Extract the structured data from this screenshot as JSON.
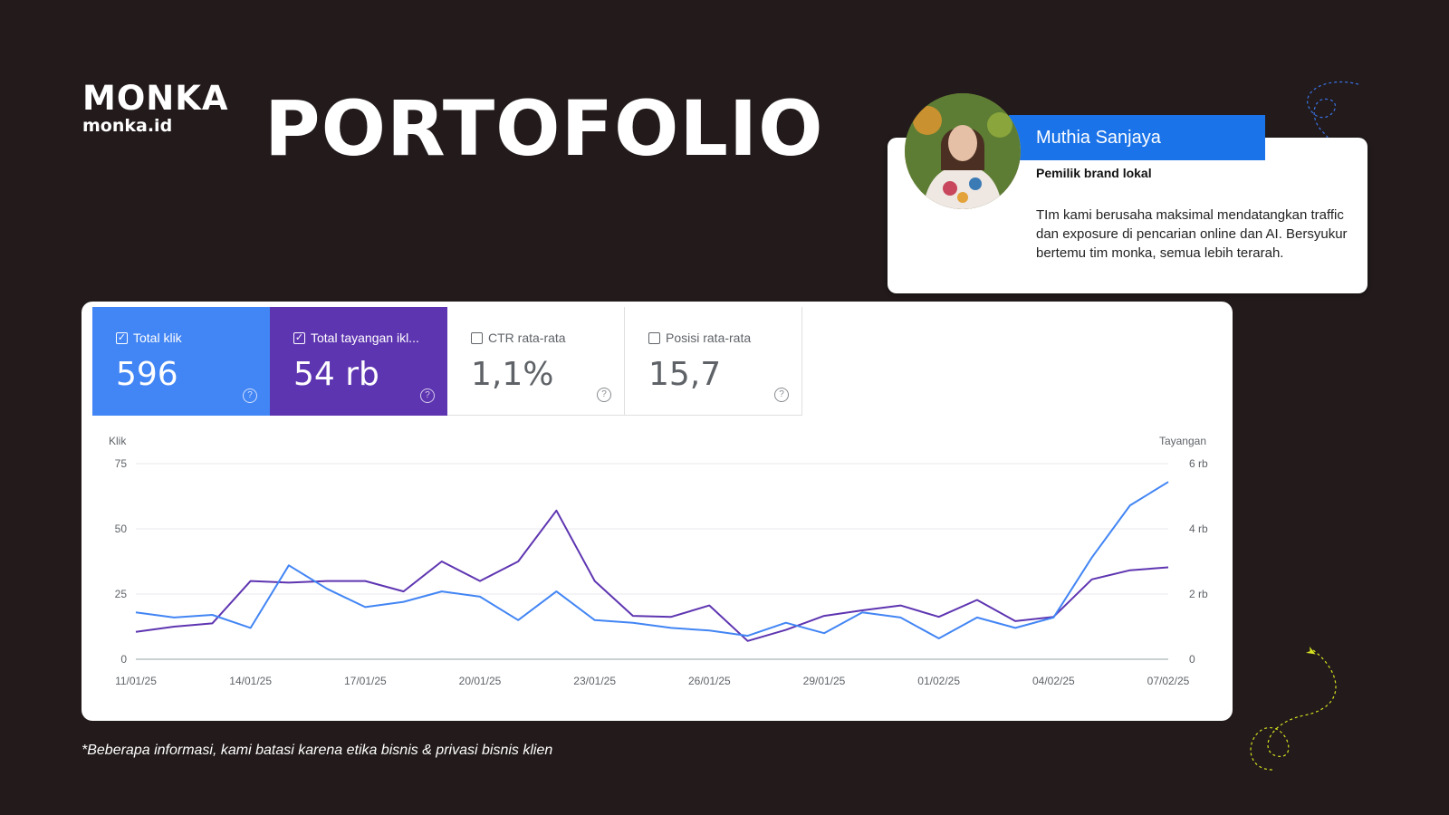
{
  "brand": {
    "wordmark": "MONKA",
    "domain": "monka.id"
  },
  "page_title": "PORTOFOLIO",
  "testimonial": {
    "name": "Muthia Sanjaya",
    "role": "Pemilik brand lokal",
    "quote": "TIm kami berusaha maksimal mendatangkan traffic dan exposure di pencarian online dan AI. Bersyukur bertemu tim monka, semua lebih terarah."
  },
  "metrics": [
    {
      "label": "Total klik",
      "value": "596",
      "checked": true,
      "color": "#4285f4"
    },
    {
      "label": "Total tayangan ikl...",
      "value": "54 rb",
      "checked": true,
      "color": "#5e35b1"
    },
    {
      "label": "CTR rata-rata",
      "value": "1,1%",
      "checked": false
    },
    {
      "label": "Posisi rata-rata",
      "value": "15,7",
      "checked": false
    }
  ],
  "chart_data": {
    "type": "line",
    "left_axis_label": "Klik",
    "right_axis_label": "Tayangan",
    "left_ticks": [
      "0",
      "25",
      "50",
      "75"
    ],
    "right_ticks": [
      "0",
      "2 rb",
      "4 rb",
      "6 rb"
    ],
    "ylim_left": [
      0,
      75
    ],
    "ylim_right": [
      0,
      6000
    ],
    "x_tick_labels": [
      "11/01/25",
      "14/01/25",
      "17/01/25",
      "20/01/25",
      "23/01/25",
      "26/01/25",
      "29/01/25",
      "01/02/25",
      "04/02/25",
      "07/02/25"
    ],
    "x": [
      "11/01/25",
      "12/01/25",
      "13/01/25",
      "14/01/25",
      "15/01/25",
      "16/01/25",
      "17/01/25",
      "18/01/25",
      "19/01/25",
      "20/01/25",
      "21/01/25",
      "22/01/25",
      "23/01/25",
      "24/01/25",
      "25/01/25",
      "26/01/25",
      "27/01/25",
      "28/01/25",
      "29/01/25",
      "30/01/25",
      "31/01/25",
      "01/02/25",
      "02/02/25",
      "03/02/25",
      "04/02/25",
      "05/02/25",
      "06/02/25",
      "07/02/25"
    ],
    "grid": true,
    "series": [
      {
        "name": "Total klik",
        "axis": "left",
        "color": "#4285f4",
        "values": [
          18,
          16,
          17,
          12,
          36,
          27,
          20,
          22,
          26,
          24,
          15,
          26,
          15,
          14,
          12,
          11,
          9,
          14,
          10,
          18,
          16,
          8,
          16,
          12,
          16,
          39,
          59,
          68
        ]
      },
      {
        "name": "Total tayangan ikl...",
        "axis": "right",
        "color": "#5e35b1",
        "values": [
          840,
          1000,
          1100,
          2400,
          2350,
          2400,
          2400,
          2080,
          3000,
          2400,
          3000,
          4560,
          2400,
          1330,
          1300,
          1650,
          560,
          900,
          1330,
          1500,
          1650,
          1300,
          1820,
          1170,
          1300,
          2450,
          2730,
          2820
        ]
      }
    ]
  },
  "footnote": "*Beberapa informasi, kami batasi karena etika bisnis & privasi bisnis klien"
}
